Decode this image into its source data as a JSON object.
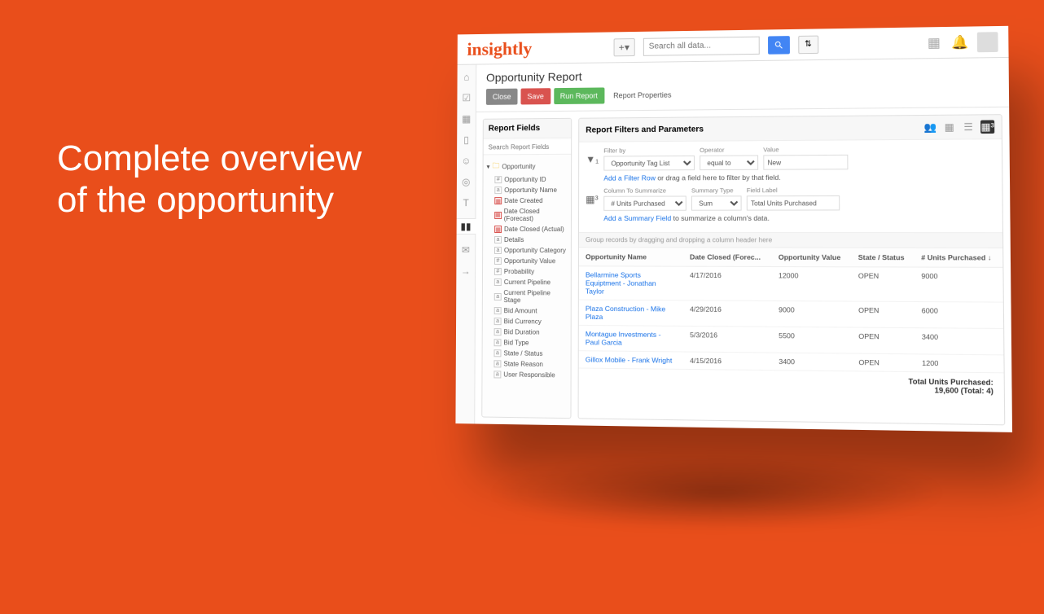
{
  "hero": {
    "headline_l1": "Complete overview",
    "headline_l2": "of the opportunity"
  },
  "brand": "insightly",
  "header": {
    "search_placeholder": "Search all data...",
    "plus_label": "+"
  },
  "page_title": "Opportunity Report",
  "toolbar": {
    "close": "Close",
    "save": "Save",
    "run": "Run Report",
    "properties": "Report Properties"
  },
  "fields_panel": {
    "title": "Report Fields",
    "search_placeholder": "Search Report Fields",
    "parent": "Opportunity",
    "items": [
      {
        "t": "#",
        "label": "Opportunity ID"
      },
      {
        "t": "a",
        "label": "Opportunity Name"
      },
      {
        "t": "d",
        "label": "Date Created"
      },
      {
        "t": "d",
        "label": "Date Closed (Forecast)"
      },
      {
        "t": "d",
        "label": "Date Closed (Actual)"
      },
      {
        "t": "a",
        "label": "Details"
      },
      {
        "t": "a",
        "label": "Opportunity Category"
      },
      {
        "t": "#",
        "label": "Opportunity Value"
      },
      {
        "t": "#",
        "label": "Probability"
      },
      {
        "t": "a",
        "label": "Current Pipeline"
      },
      {
        "t": "a",
        "label": "Current Pipeline Stage"
      },
      {
        "t": "a",
        "label": "Bid Amount"
      },
      {
        "t": "a",
        "label": "Bid Currency"
      },
      {
        "t": "a",
        "label": "Bid Duration"
      },
      {
        "t": "a",
        "label": "Bid Type"
      },
      {
        "t": "a",
        "label": "State / Status"
      },
      {
        "t": "a",
        "label": "State Reason"
      },
      {
        "t": "a",
        "label": "User Responsible"
      }
    ]
  },
  "report": {
    "title": "Report Filters and Parameters",
    "filter": {
      "filter_by_label": "Filter by",
      "filter_by_value": "Opportunity Tag List",
      "operator_label": "Operator",
      "operator_value": "equal to",
      "value_label": "Value",
      "value_value": "New",
      "add_filter_link": "Add a Filter Row",
      "add_filter_suffix": " or drag a field here to filter by that field."
    },
    "summary": {
      "col_label": "Column To Summarize",
      "col_value": "# Units Purchased",
      "type_label": "Summary Type",
      "type_value": "Sum",
      "field_label_label": "Field Label",
      "field_label_value": "Total Units Purchased",
      "add_summary_link": "Add a Summary Field",
      "add_summary_suffix": " to summarize a column's data."
    },
    "group_hint": "Group records by dragging and dropping a column header here",
    "columns": [
      "Opportunity Name",
      "Date Closed (Forec...",
      "Opportunity Value",
      "State / Status",
      "# Units Purchased ↓"
    ],
    "rows": [
      {
        "name": "Bellarmine Sports Equiptment - Jonathan Taylor",
        "date": "4/17/2016",
        "value": "12000",
        "status": "OPEN",
        "units": "9000"
      },
      {
        "name": "Plaza Construction - Mike Plaza",
        "date": "4/29/2016",
        "value": "9000",
        "status": "OPEN",
        "units": "6000"
      },
      {
        "name": "Montague Investments - Paul Garcia",
        "date": "5/3/2016",
        "value": "5500",
        "status": "OPEN",
        "units": "3400"
      },
      {
        "name": "Gillox Mobile - Frank Wright",
        "date": "4/15/2016",
        "value": "3400",
        "status": "OPEN",
        "units": "1200"
      }
    ],
    "footer_label": "Total Units Purchased:",
    "footer_value": "19,600 (Total: 4)"
  }
}
